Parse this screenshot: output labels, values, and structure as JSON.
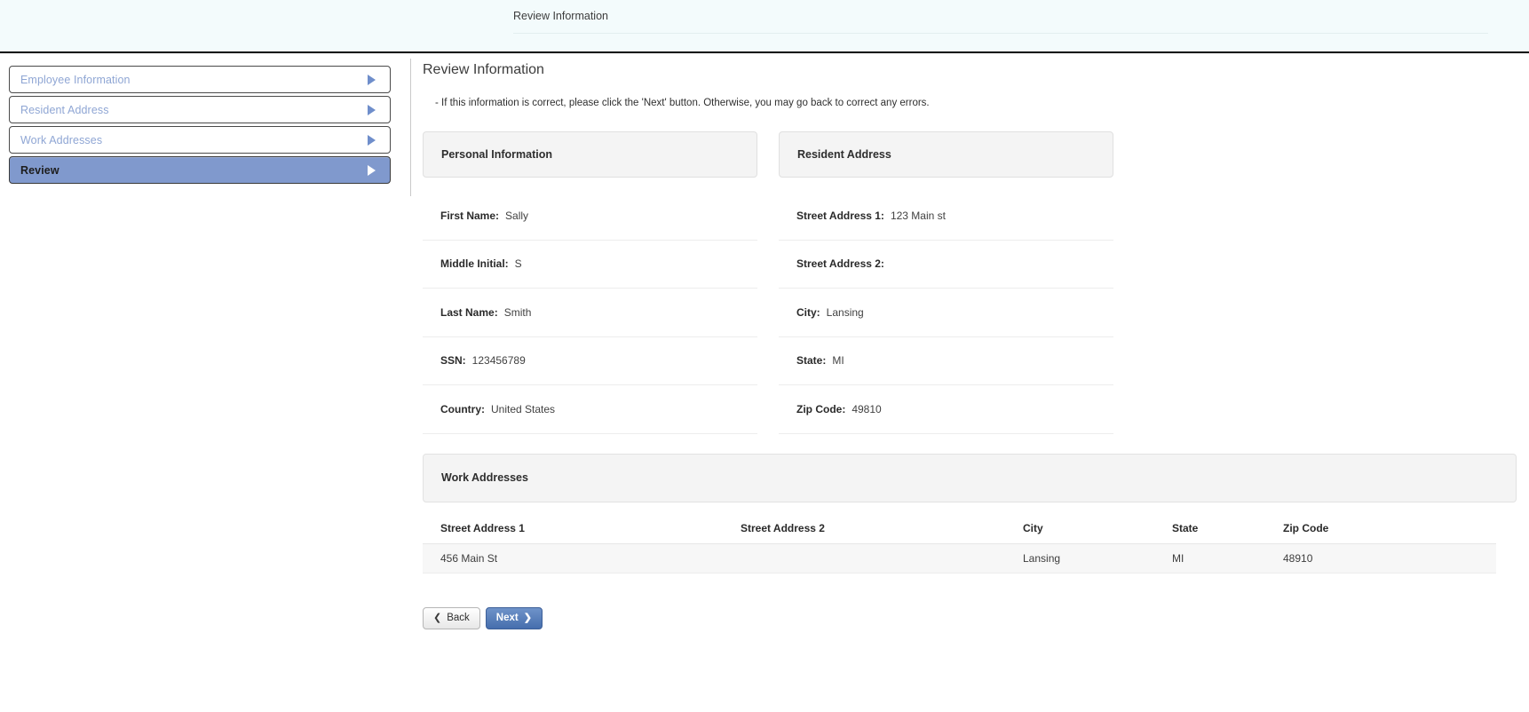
{
  "header": {
    "title": "Review Information"
  },
  "sidebar": {
    "items": [
      {
        "label": "Employee Information",
        "icon": "caret-right-icon",
        "active": false
      },
      {
        "label": "Resident Address",
        "icon": "caret-right-icon",
        "active": false
      },
      {
        "label": "Work Addresses",
        "icon": "caret-right-icon",
        "active": false
      },
      {
        "label": "Review",
        "icon": "caret-right-icon",
        "active": true
      }
    ]
  },
  "main": {
    "page_title": "Review Information",
    "hint": "- If this information is correct, please click the 'Next' button. Otherwise, you may go back to correct any errors.",
    "personal_information": {
      "heading": "Personal Information",
      "fields": [
        {
          "label": "First Name:",
          "value": "Sally"
        },
        {
          "label": "Middle Initial:",
          "value": "S"
        },
        {
          "label": "Last Name:",
          "value": "Smith"
        },
        {
          "label": "SSN:",
          "value": "123456789"
        },
        {
          "label": "Country:",
          "value": "United States"
        }
      ]
    },
    "resident_address": {
      "heading": "Resident Address",
      "fields": [
        {
          "label": "Street Address 1:",
          "value": "123 Main st"
        },
        {
          "label": "Street Address 2:",
          "value": ""
        },
        {
          "label": "City:",
          "value": "Lansing"
        },
        {
          "label": "State:",
          "value": "MI"
        },
        {
          "label": "Zip Code:",
          "value": "49810"
        }
      ]
    },
    "work_addresses": {
      "heading": "Work Addresses",
      "columns": [
        "Street Address 1",
        "Street Address 2",
        "City",
        "State",
        "Zip Code"
      ],
      "rows": [
        {
          "street_address_1": "456 Main St",
          "street_address_2": "",
          "city": "Lansing",
          "state": "MI",
          "zip_code": "48910"
        }
      ]
    }
  },
  "footer": {
    "back_label": "Back",
    "next_label": "Next",
    "back_icon": "chevron-left-icon",
    "next_icon": "chevron-right-icon"
  },
  "colors": {
    "accent_blue": "#8099cd",
    "nav_text_blue": "#8fa6d4",
    "next_button_blue": "#466ead",
    "header_band": "#f3fbfc",
    "panel_head_gray": "#f4f4f4"
  }
}
